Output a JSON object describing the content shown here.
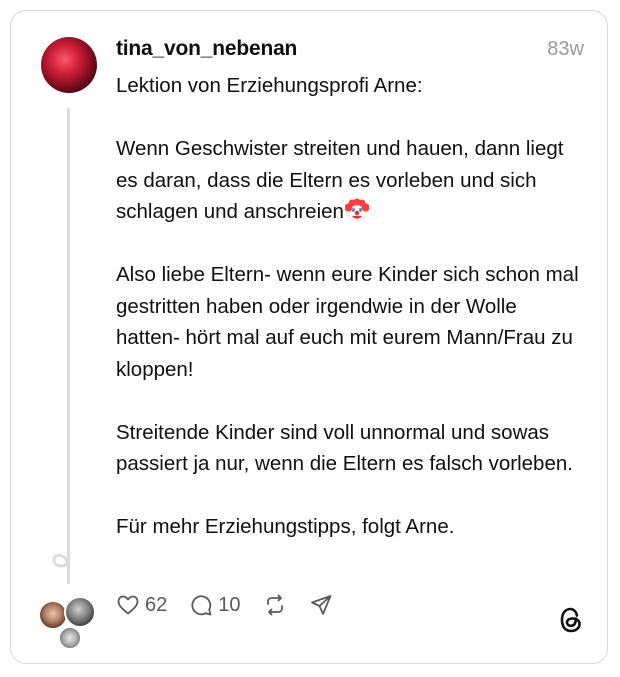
{
  "post": {
    "username": "tina_von_nebenan",
    "time": "83w",
    "text": "Lektion von Erziehungsprofi Arne:\n\nWenn Geschwister streiten und hauen, dann liegt es daran, dass die Eltern es vorleben und sich schlagen und anschreien",
    "text_after_emoji": "\n\nAlso liebe Eltern- wenn eure Kinder sich schon mal gestritten haben oder irgendwie in der Wolle hatten- hört mal auf euch mit eurem Mann/Frau zu kloppen!\n\nStreitende Kinder sind voll unnormal und sowas passiert ja nur, wenn die Eltern es falsch vorleben.\n\nFür mehr Erziehungstipps, folgt Arne.",
    "emoji": "clown-face-icon"
  },
  "actions": {
    "likes": "62",
    "replies": "10",
    "icons": [
      "heart-icon",
      "comment-icon",
      "repost-icon",
      "share-icon"
    ]
  },
  "branding": {
    "logo": "threads-logo-icon"
  },
  "colors": {
    "text": "#101010",
    "muted": "#9a9a9a",
    "border": "#d9d9d9"
  }
}
